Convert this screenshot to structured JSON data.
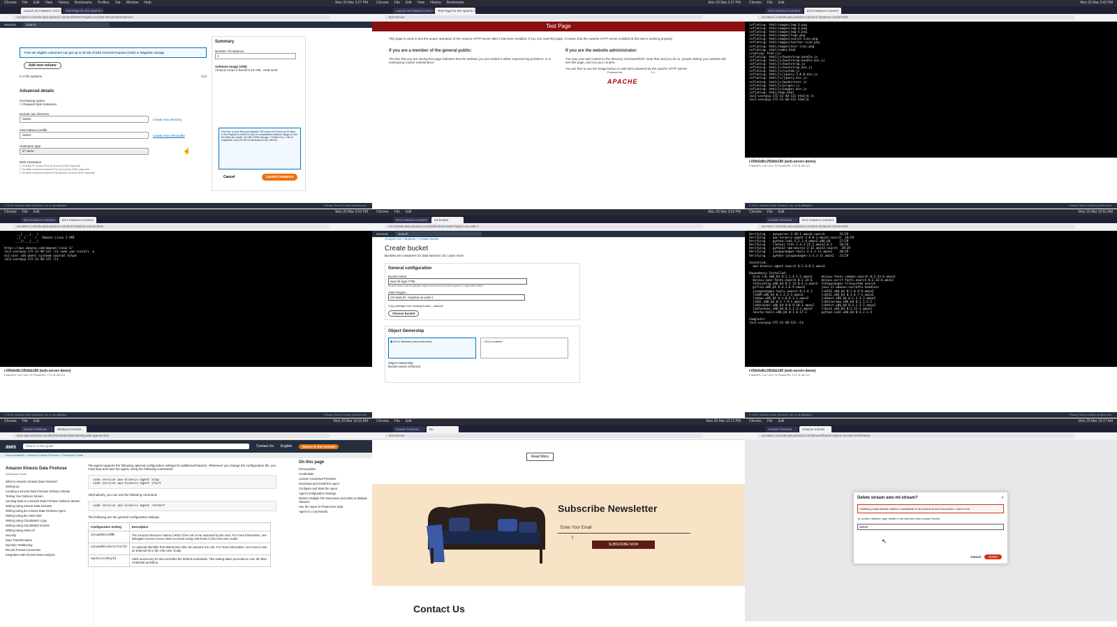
{
  "menubar": {
    "items": [
      "Chrome",
      "File",
      "Edit",
      "View",
      "History",
      "Bookmarks",
      "Profiles",
      "Tab",
      "Window",
      "Help"
    ],
    "times": [
      "Mon 20 Mar 3:27 PM",
      "Mon 20 Mar 3:42 PM",
      "Mon 20 Mar 3:52 PM",
      "Mon 20 Mar 3:52 PM",
      "Mon 20 Mar 10:51 AM",
      "Mon 20 Mar 12:12 PM",
      "Mon 20 Mar 10:17 AM"
    ]
  },
  "tile0": {
    "tabs": [
      "Launch an instance | EC2 M...",
      "Test Page for the Apache HTT..."
    ],
    "search": "Search",
    "info": "Free tier eligible customers can get up to 30 GB of EBS General Purpose (SSD) or Magnetic storage",
    "add_volume": "Add new volume",
    "file_systems": "0 x File systems",
    "edit": "Edit",
    "advanced": "Advanced details",
    "purchasing": "Purchasing option",
    "spot": "Request Spot Instances",
    "domain_join": "Domain join directory",
    "select": "Select",
    "create_dir": "Create new directory",
    "iam": "IAM instance profile",
    "create_profile": "Create new IAM profile",
    "hostname_type": "Hostname type",
    "ip_name": "IP name",
    "dns": "DNS Hostname",
    "dns1": "Enable IP name IPv4 (A record) DNS requests",
    "dns2": "Enable resource-based IPv4 (A record) DNS requests",
    "dns3": "Enable resource-based IPv6 (AAAA record) DNS requests",
    "summary": "Summary",
    "instances_label": "Number of instances",
    "instances": "1",
    "software": "Software Image (AMI)",
    "ami": "Amazon Linux 2 Kernel 5.10 AMI...read more",
    "tip": "Free tier: In your first year includes 750 hours of t2.micro (or t3.micro in the Regions in which t2.micro is unavailable) instance usage on free tier AMIs per month, 30 GiB of EBS storage, 2 million IOs, 1 GB of snapshots, and 100 GB of bandwidth to the internet.",
    "cancel": "Cancel",
    "launch": "Launch instance",
    "footer": "© 2023, Amazon Web Services, Inc. or its affiliates.",
    "footer_links": "Privacy   Terms   Cookie preferences"
  },
  "tile1": {
    "url": "Not Secure",
    "banner": "Test Page",
    "intro": "This page is used to test the proper operation of the Apache HTTP server after it has been installed. If you can read this page, it means that the Apache HTTP server installed at this site is working properly.",
    "public_h": "If you are a member of the general public:",
    "public_p": "The fact that you are seeing this page indicates that the website you just visited is either experiencing problems, or is undergoing routine maintenance.",
    "admin_h": "If you are the website administrator:",
    "admin_p": "You may now add content to the directory /var/www/html/. Note that until you do so, people visiting your website will see this page, and not your content.",
    "admin_p2": "You are free to use the image below on web sites powered by the Apache HTTP Server:",
    "powered": "Powered by",
    "apache": "APACHE",
    "version": "2.4"
  },
  "tile2": {
    "lines": [
      "inflating: html/images/img-3.png",
      "inflating: html/images/img-4.png",
      "inflating: html/images/img-5.png",
      "inflating: html/images/logo.png",
      "inflating: html/images/search-icon.png",
      "inflating: html/images/twitter-icon.png",
      "inflating: html/images/user-icon.png",
      "inflating: html/index.html",
      "creating: html/js/",
      "inflating: html/js/bootstrap.bundle.js",
      "inflating: html/js/bootstrap.bundle.min.js",
      "inflating: html/js/bootstrap.js",
      "inflating: html/js/bootstrap.min.js",
      "inflating: html/js/custom.js",
      "inflating: html/js/jquery-3.0.0.min.js",
      "inflating: html/js/jquery.min.js",
      "inflating: html/js/modernizer.js",
      "inflating: html/js/plugin.js",
      "inflating: html/js/popper.min.js",
      "inflating: html/shop.html",
      "[ec2-user@ip-172-31-48-121 html]$ ls",
      "[ec2-user@ip-172-31-48-121 html]$ "
    ],
    "instance": "i-05fe6d6c1f5dbb190 (web-server-demo)",
    "ips": "PublicIPs: 3.87.241.72   PrivateIPs: 172.31.48.121"
  },
  "tile3": {
    "lines": [
      "       __|  __|_  )",
      "       _|  (     /   Amazon Linux 2 AMI",
      "      ___|\\___|___|",
      "",
      "https://aws.amazon.com/amazon-linux-2/",
      "[ec2-user@ip-172-31-48-121 ~]$ sudo yum install -y",
      "ec2-user sdk wheel systemd-journal httpd",
      "[ec2-user@ip-172-31-48-121 ~]$ "
    ],
    "instance": "i-05fe6d6c1f5dbb190 (web-server-demo)",
    "ips": "PublicIPs: 3.87.241.72   PrivateIPs: 172.31.48.121"
  },
  "tile4": {
    "crumbs": "Amazon S3  >  Buckets  >  Create bucket",
    "title": "Create bucket",
    "subtitle": "Buckets are containers for data stored in S3. Learn more",
    "general": "General configuration",
    "bucket_label": "Bucket name",
    "bucket_value": "aws-ml-logs-7756",
    "bucket_hint": "Bucket name must be globally unique and must not contain spaces or uppercase letters.",
    "region_label": "AWS Region",
    "region_value": "US East (N. Virginia) us-east-1",
    "copy_label": "Copy settings from existing bucket - optional",
    "choose": "Choose bucket",
    "ownership": "Object Ownership",
    "acl_off": "ACLs disabled (recommended)",
    "acl_on": "ACLs enabled",
    "owner": "Object Ownership",
    "owner_value": "Bucket owner enforced"
  },
  "tile5": {
    "lines": [
      "Verifying  : pycparser-2.20-1.amzn2.noarch        15/29",
      "Verifying  : aws-kinesis-agent-2.0.8-1.amzn2.noarch  16/29",
      "Verifying  : python-lxml-3.2.1-4.amzn2.x86_64     17/29",
      "Verifying  : libtool-ltdl-2.4.2-22.2.amzn2.0.2    18/29",
      "Verifying  : python2-rpm-macros-3-32.amzn2.noarch  19/29",
      "Verifying  : javapackages-tools-3.4.1-11.amzn2    20/29",
      "Verifying  : python-javapackages-3.4.1-11.amzn2   21/29",
      "",
      "Installed:",
      "  aws-kinesis-agent.noarch 0:2.0.8-1.amzn2",
      "",
      "Dependency Installed:",
      "  alsa-lib.x86_64 0:1.1.4.1-2.amzn2     dejavu-fonts-common.noarch 0:2.33-6.amzn2",
      "  dejavu-sans-fonts.noarch 0:2.33-6     dejavu-serif-fonts.noarch 0:2.33-6.amzn2",
      "  fontconfig.x86_64 0:2.13.0-4.3.amzn2  fontpackages-filesystem.noarch",
      "  giflib.x86_64 0:4.1.6-9.amzn2         java-11-amazon-corretto-headless",
      "  javapackages-tools.noarch 0:3.4.1     libICE.x86_64 0:1.0.9-9.amzn2",
      "  libSM.x86_64 0:1.2.2-2.amzn2          libX11.x86_64 0:1.6.7-3.amzn2",
      "  libXau.x86_64 0:1.0.8-2.1.amzn2       libXext.x86_64 0:1.3.3-3.amzn2",
      "  libXi.x86_64 0:1.7.9-1.amzn2          libXinerama.x86_64 0:1.1.3-2",
      "  libXrender.x86_64 0:0.9.10-1.amzn2    libXtst.x86_64 0:1.2.3-1.amzn2",
      "  libfontenc.x86_64 0:1.1.3-3.amzn2     libxcb.x86_64 0:1.12-1.amzn2",
      "  lksctp-tools.x86_64 0:1.0.17-2        python-lxml.x86_64 0:3.2.1-4",
      "",
      "Complete!",
      "[ec2-user@ip-172-31-48-121 ~]$ "
    ],
    "instance": "i-05fe6d6c1f5dbb190 (web-server-demo)",
    "ips": "PublicIPs: 3.87.241.72   PrivateIPs: 172.31.48.121"
  },
  "tile6": {
    "logo": "aws",
    "search": "Search in this guide",
    "contact": "Contact Us",
    "lang": "English",
    "return": "Return to the Console",
    "crumbs": "Documentation  >  Amazon Kinesis Firehose  >  Developer Guide",
    "side_title": "Amazon Kinesis Data Firehose",
    "side_sub": "Developer Guide",
    "side": [
      "What Is Amazon Kinesis Data Firehose?",
      "Setting Up",
      "Creating a Kinesis Data Firehose Delivery Stream",
      "Testing Your Delivery Stream",
      "Sending Data to a Kinesis Data Firehose Delivery Stream",
      "Writing Using Kinesis Data Streams",
      "Writing Using the Kinesis Data Firehose Agent",
      "Writing Using the AWS SDK",
      "Writing Using CloudWatch Logs",
      "Writing Using CloudWatch Events",
      "Writing Using AWS IoT",
      "Security",
      "Data Transformation",
      "Dynamic Partitioning",
      "Record Format Conversion",
      "Integration with Kinesis Data Analytics"
    ],
    "p1": "The agent supports the following optional configuration settings for additional features. Whenever you change the configuration file, you must stop and start the agent, using the following commands:",
    "code1": "sudo service aws-kinesis-agent stop\nsudo service aws-kinesis-agent start",
    "p2": "Alternatively, you can use the following command:",
    "code2": "sudo service aws-kinesis-agent restart",
    "p3": "The following are the general configuration settings.",
    "th1": "Configuration Setting",
    "th2": "Description",
    "rows": [
      [
        "assumeRoleARN",
        "The Amazon Resource Name (ARN) of the role to be assumed by the user. For more information, see Delegate Access Across AWS Accounts Using IAM Roles in the IAM User Guide."
      ],
      [
        "assumeRoleExternalId",
        "An optional identifier that determines who can assume the role. For more information, see How to Use an External ID in the IAM User Guide."
      ],
      [
        "awsAccessKeyId",
        "AWS access key ID that overrides the default credentials. This setting takes precedence over all other credential providers."
      ]
    ],
    "toc_title": "On this page",
    "toc": [
      "Prerequisites",
      "Credentials",
      "Custom Credential Providers",
      "Download and Install the Agent",
      "Configure and Start the Agent",
      "Agent Configuration Settings",
      "Monitor Multiple File Directories and Write to Multiple Streams",
      "Use the Agent to Preprocess Data",
      "Agent CLI Commands"
    ]
  },
  "tile7": {
    "read_more": "Read More",
    "newsletter": "Subscribe Newsletter",
    "email_placeholder": "Enter Your Email",
    "subscribe": "SUBSCRIBE NOW",
    "contact": "Contact Us"
  },
  "tile8": {
    "modal_title": "Delete stream aws-ml-stream?",
    "warn": "Deleting a data stream makes it unavailable to all producers and consumers. Learn more",
    "confirm": "To confirm deletion, type delete in the field and then choose Delete.",
    "input_value": "delete",
    "cancel": "Cancel",
    "delete": "Delete"
  }
}
